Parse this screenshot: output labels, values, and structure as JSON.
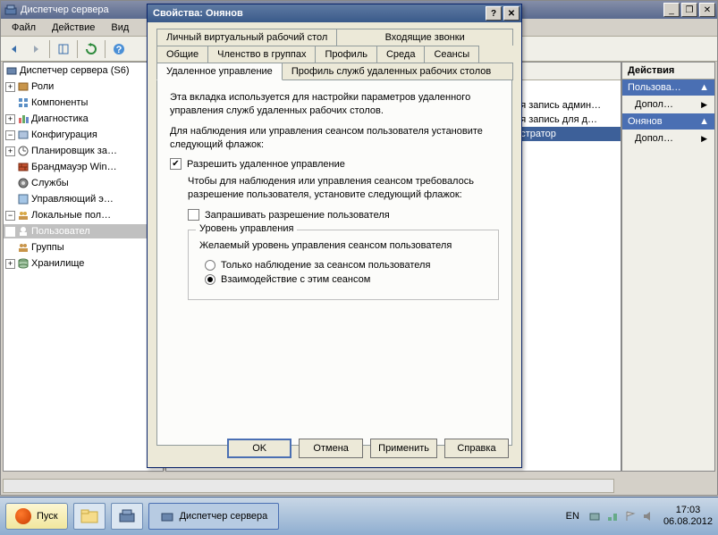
{
  "app": {
    "title": "Диспетчер сервера",
    "menu": {
      "file": "Файл",
      "action": "Действие",
      "view": "Вид"
    }
  },
  "tree": {
    "root": "Диспетчер сервера (S6)",
    "roles": "Роли",
    "components": "Компоненты",
    "diagnostics": "Диагностика",
    "config": "Конфигурация",
    "scheduler": "Планировщик за…",
    "firewall": "Брандмауэр Win…",
    "services": "Службы",
    "wmi": "Управляющий э…",
    "localusers": "Локальные пол…",
    "users": "Пользовател",
    "groups": "Группы",
    "storage": "Хранилище"
  },
  "list": {
    "r1": "ная запись админ…",
    "r2": "ная запись для д…",
    "r3": "нистратор"
  },
  "actions": {
    "title": "Действия",
    "head1": "Пользова…",
    "more": "Допол…",
    "head2": "Онянов"
  },
  "dialog": {
    "title": "Свойства: Онянов",
    "tabs": {
      "pvdesktop": "Личный виртуальный рабочий стол",
      "incoming": "Входящие звонки",
      "general": "Общие",
      "membership": "Членство в группах",
      "profile": "Профиль",
      "env": "Среда",
      "sessions": "Сеансы",
      "remote": "Удаленное управление",
      "rdsprofile": "Профиль служб удаленных рабочих столов"
    },
    "p1": "Эта вкладка используется для настройки параметров удаленного управления служб удаленных рабочих столов.",
    "p2": "Для наблюдения или управления сеансом пользователя установите следующий флажок:",
    "chk_allow": "Разрешить удаленное управление",
    "p3": "Чтобы для наблюдения или управления сеансом требовалось разрешение пользователя, установите следующий флажок:",
    "chk_ask": "Запрашивать разрешение пользователя",
    "group_title": "Уровень управления",
    "group_desc": "Желаемый уровень управления сеансом пользователя",
    "r_observe": "Только наблюдение за сеансом пользователя",
    "r_interact": "Взаимодействие с этим сеансом",
    "btn_ok": "OK",
    "btn_cancel": "Отмена",
    "btn_apply": "Применить",
    "btn_help": "Справка"
  },
  "taskbar": {
    "start": "Пуск",
    "task": "Диспетчер сервера",
    "lang": "EN",
    "time": "17:03",
    "date": "06.08.2012"
  }
}
